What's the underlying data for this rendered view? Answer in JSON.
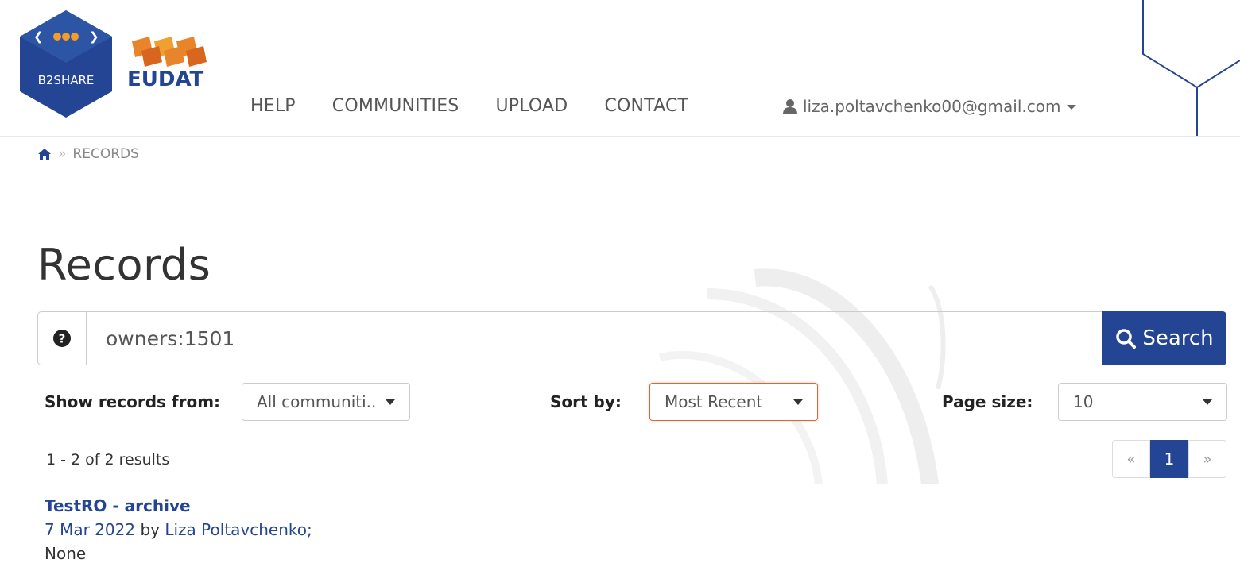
{
  "header": {
    "b2share_logo_text": "B2SHARE",
    "eudat_logo_text": "EUDAT",
    "nav": [
      "HELP",
      "COMMUNITIES",
      "UPLOAD",
      "CONTACT"
    ],
    "user_email": "liza.poltavchenko00@gmail.com"
  },
  "breadcrumb": {
    "sep": "»",
    "current": "RECORDS"
  },
  "page_title": "Records",
  "search": {
    "value": "owners:1501",
    "button_label": "Search"
  },
  "filters": {
    "community_label": "Show records from:",
    "community_value": "All communiti...",
    "sort_label": "Sort by:",
    "sort_value": "Most Recent",
    "pagesize_label": "Page size:",
    "pagesize_value": "10"
  },
  "results": {
    "count_text": "1 - 2 of 2 results"
  },
  "pager": {
    "prev": "«",
    "current": "1",
    "next": "»"
  },
  "records": [
    {
      "title": "TestRO - archive",
      "date": "7 Mar 2022",
      "by": "by",
      "author": "Liza Poltavchenko;",
      "description": "None"
    }
  ],
  "colors": {
    "brand": "#234593",
    "accent_orange": "#e8852a",
    "focus": "#d26a3b"
  }
}
